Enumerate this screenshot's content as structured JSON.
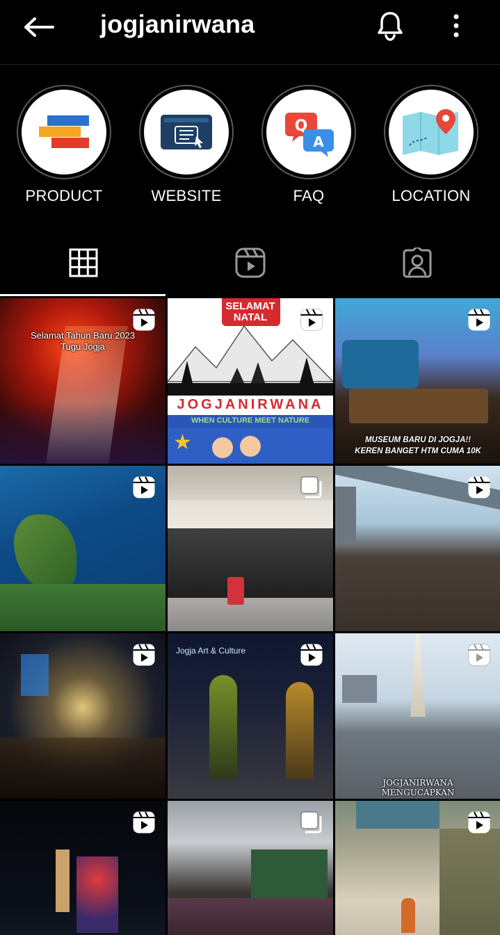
{
  "header": {
    "username": "jogjanirwana",
    "back_icon": "arrow-left-icon",
    "bell_icon": "bell-icon",
    "more_icon": "more-vertical-icon"
  },
  "highlights": [
    {
      "label": "PRODUCT",
      "icon": "product-stripes-icon"
    },
    {
      "label": "WEBSITE",
      "icon": "website-icon"
    },
    {
      "label": "FAQ",
      "icon": "qa-bubbles-icon"
    },
    {
      "label": "LOCATION",
      "icon": "map-pin-icon"
    }
  ],
  "tabs": [
    {
      "icon": "grid-icon",
      "active": true
    },
    {
      "icon": "reels-icon",
      "active": false
    },
    {
      "icon": "tagged-icon",
      "active": false
    }
  ],
  "posts": [
    {
      "type": "reel",
      "caption1": "Selamat Tahun Baru 2023",
      "caption2": "Tugu Jogja"
    },
    {
      "type": "reel",
      "caption1": "SELAMAT",
      "caption2": "NATAL",
      "brand": "JOGJANIRWANA",
      "tagline": "WHEN CULTURE MEET NATURE"
    },
    {
      "type": "reel",
      "caption1": "MUSEUM BARU DI JOGJA!!",
      "caption2": "KEREN BANGET HTM CUMA 10K"
    },
    {
      "type": "reel"
    },
    {
      "type": "carousel"
    },
    {
      "type": "reel"
    },
    {
      "type": "reel"
    },
    {
      "type": "reel",
      "caption1": "Jogja Art & Culture"
    },
    {
      "type": "reel",
      "caption1": "JOGJANIRWANA",
      "caption2": "MENGUCAPKAN"
    },
    {
      "type": "reel"
    },
    {
      "type": "carousel"
    },
    {
      "type": "reel"
    }
  ],
  "colors": {
    "background": "#000000",
    "text": "#ffffff",
    "divider": "#262626"
  }
}
